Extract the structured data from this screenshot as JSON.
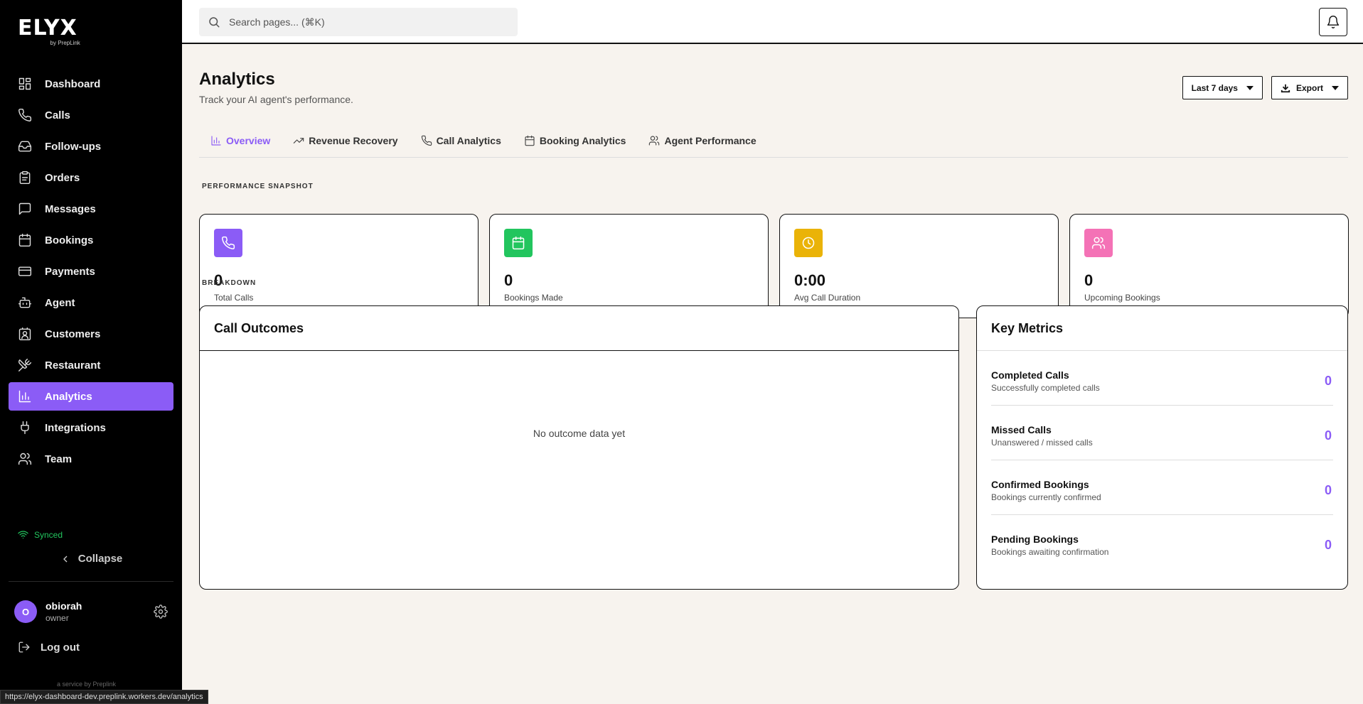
{
  "brand": {
    "name": "ELYX",
    "tagline": "by PrepLink",
    "service": "a service by Preplink"
  },
  "sidebar": {
    "items": [
      {
        "label": "Dashboard",
        "icon": "dashboard-icon"
      },
      {
        "label": "Calls",
        "icon": "phone-icon"
      },
      {
        "label": "Follow-ups",
        "icon": "inbox-icon"
      },
      {
        "label": "Orders",
        "icon": "clipboard-icon"
      },
      {
        "label": "Messages",
        "icon": "message-icon"
      },
      {
        "label": "Bookings",
        "icon": "calendar-icon"
      },
      {
        "label": "Payments",
        "icon": "credit-card-icon"
      },
      {
        "label": "Agent",
        "icon": "robot-icon"
      },
      {
        "label": "Customers",
        "icon": "contact-icon"
      },
      {
        "label": "Restaurant",
        "icon": "utensils-icon"
      },
      {
        "label": "Analytics",
        "icon": "bar-chart-icon",
        "active": true
      },
      {
        "label": "Integrations",
        "icon": "plug-icon"
      },
      {
        "label": "Team",
        "icon": "users-icon"
      }
    ],
    "synced_label": "Synced",
    "collapse_label": "Collapse",
    "user": {
      "initial": "O",
      "name": "obiorah",
      "role": "owner"
    },
    "logout_label": "Log out"
  },
  "status_url": "https://elyx-dashboard-dev.preplink.workers.dev/analytics",
  "search": {
    "placeholder": "Search pages... (⌘K)"
  },
  "page": {
    "title": "Analytics",
    "subtitle": "Track your AI agent's performance.",
    "range_label": "Last 7 days",
    "export_label": "Export"
  },
  "tabs": [
    {
      "label": "Overview",
      "active": true
    },
    {
      "label": "Revenue Recovery"
    },
    {
      "label": "Call Analytics"
    },
    {
      "label": "Booking Analytics"
    },
    {
      "label": "Agent Performance"
    }
  ],
  "snapshot_label": "PERFORMANCE SNAPSHOT",
  "cards": [
    {
      "value": "0",
      "label": "Total Calls",
      "color": "#8b5cf6",
      "icon": "phone-icon"
    },
    {
      "value": "0",
      "label": "Bookings Made",
      "color": "#22c55e",
      "icon": "calendar-icon"
    },
    {
      "value": "0:00",
      "label": "Avg Call Duration",
      "color": "#eab308",
      "icon": "clock-icon"
    },
    {
      "value": "0",
      "label": "Upcoming Bookings",
      "color": "#f472b6",
      "icon": "users-icon"
    }
  ],
  "breakdown_label": "BREAKDOWN",
  "outcomes": {
    "title": "Call Outcomes",
    "empty": "No outcome data yet"
  },
  "metrics": {
    "title": "Key Metrics",
    "items": [
      {
        "title": "Completed Calls",
        "desc": "Successfully completed calls",
        "value": "0"
      },
      {
        "title": "Missed Calls",
        "desc": "Unanswered / missed calls",
        "value": "0"
      },
      {
        "title": "Confirmed Bookings",
        "desc": "Bookings currently confirmed",
        "value": "0"
      },
      {
        "title": "Pending Bookings",
        "desc": "Bookings awaiting confirmation",
        "value": "0"
      }
    ]
  }
}
